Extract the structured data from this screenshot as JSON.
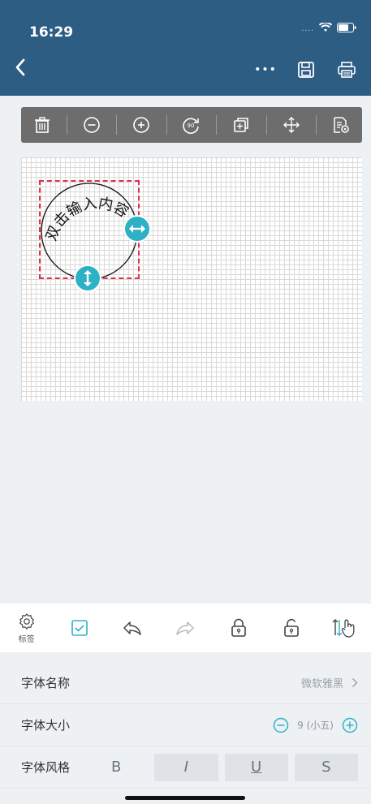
{
  "status": {
    "time": "16:29"
  },
  "nav": {
    "back_icon": "chevron-left-icon",
    "more_label": "•••"
  },
  "toolbar": {
    "icons": [
      "trash-icon",
      "zoom-out-icon",
      "zoom-in-icon",
      "rotate-90-icon",
      "duplicate-icon",
      "move-icon",
      "properties-icon"
    ],
    "rotate_badge": "90"
  },
  "canvas": {
    "seal_text": "双击输入内容"
  },
  "bottom_toolbar": {
    "label_tab": "标签",
    "icons": [
      "gear-icon",
      "checkbox-icon",
      "undo-icon",
      "redo-icon",
      "lock-icon",
      "unlock-icon",
      "touch-sort-icon"
    ]
  },
  "font_settings": {
    "name_label": "字体名称",
    "name_value": "微软雅黑",
    "size_label": "字体大小",
    "size_value": "9 (小五)",
    "style_label": "字体风格",
    "style_bold": "B",
    "style_italic": "I",
    "style_underline": "U",
    "style_strike": "S"
  },
  "colors": {
    "header": "#2e5d84",
    "accent": "#2fb1c5",
    "selection": "#e0314b"
  }
}
